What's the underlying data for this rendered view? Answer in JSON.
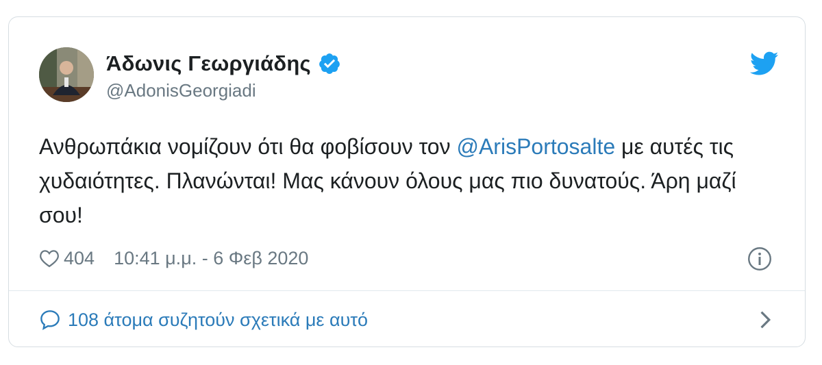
{
  "user": {
    "display_name": "Άδωνις Γεωργιάδης",
    "handle": "@AdonisGeorgiadi",
    "verified": true
  },
  "tweet": {
    "text_before": "Ανθρωπάκια νομίζουν ότι θα φοβίσουν τον ",
    "mention": "@ArisPortosalte",
    "text_after": " με αυτές τις χυδαιότητες. Πλανώνται! Μας κάνουν όλους μας πιο δυνατούς. Άρη μαζί σου!"
  },
  "meta": {
    "likes": "404",
    "timestamp": "10:41 μ.μ. - 6 Φεβ 2020"
  },
  "footer": {
    "discussion_label": "108 άτομα συζητούν σχετικά με αυτό"
  },
  "icons": {
    "verified": "verified-badge-icon",
    "logo": "twitter-bird-icon",
    "like": "heart-icon",
    "info": "info-icon",
    "reply": "speech-bubble-icon",
    "chevron": "chevron-right-icon"
  },
  "colors": {
    "accent": "#1da1f2",
    "link": "#2b7bb9",
    "secondary_text": "#697882",
    "border": "#d6dde2"
  }
}
